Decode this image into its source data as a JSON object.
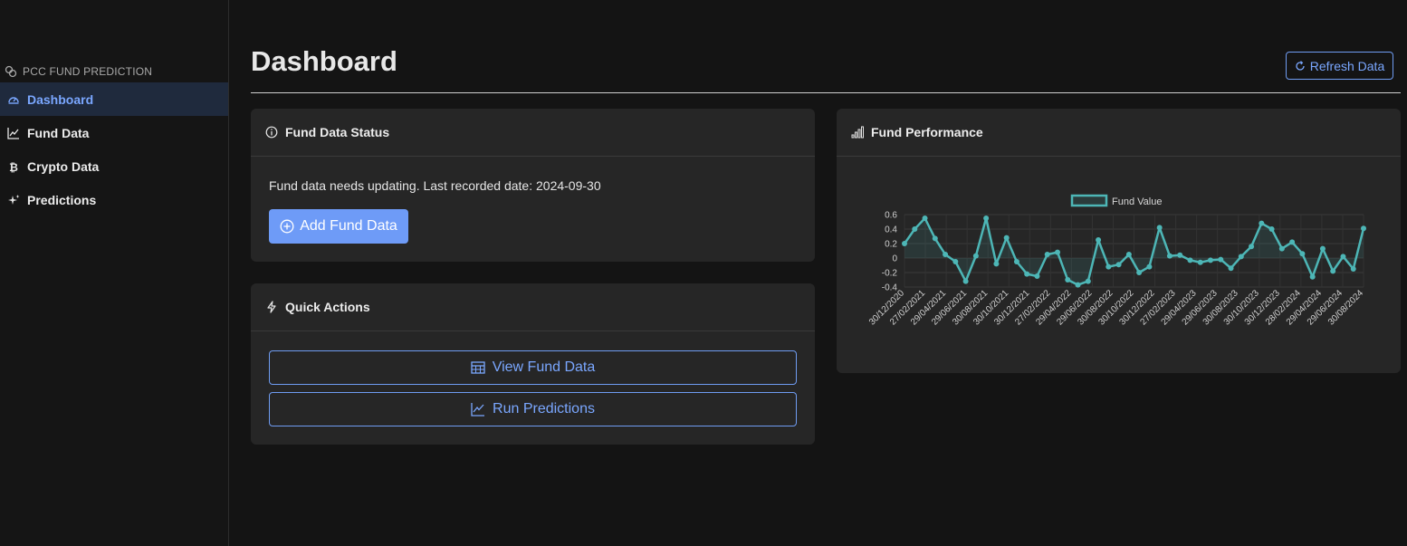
{
  "sidebar": {
    "brand": "PCC FUND PREDICTION",
    "items": [
      {
        "label": "Dashboard",
        "icon": "gauge-icon"
      },
      {
        "label": "Fund Data",
        "icon": "line-chart-icon"
      },
      {
        "label": "Crypto Data",
        "icon": "bitcoin-icon"
      },
      {
        "label": "Predictions",
        "icon": "sparkles-icon"
      }
    ]
  },
  "header": {
    "title": "Dashboard",
    "refresh_label": "Refresh Data"
  },
  "status_card": {
    "title": "Fund Data Status",
    "message": "Fund data needs updating. Last recorded date: 2024-09-30",
    "add_label": "Add Fund Data"
  },
  "actions_card": {
    "title": "Quick Actions",
    "view_label": "View Fund Data",
    "predict_label": "Run Predictions"
  },
  "performance_card": {
    "title": "Fund Performance"
  },
  "colors": {
    "accent": "#7aa7ff",
    "line": "#4db6b6",
    "active_nav_bg": "#1f2a3d"
  },
  "chart_data": {
    "type": "line",
    "legend": "top",
    "ylim": [
      -0.4,
      0.6
    ],
    "yticks": [
      0.6,
      0.4,
      0.2,
      0,
      -0.2,
      -0.4
    ],
    "xtick_labels": [
      "30/12/2020",
      "27/02/2021",
      "29/04/2021",
      "29/06/2021",
      "30/08/2021",
      "30/10/2021",
      "30/12/2021",
      "27/02/2022",
      "29/04/2022",
      "29/06/2022",
      "30/08/2022",
      "30/10/2022",
      "30/12/2022",
      "27/02/2023",
      "29/04/2023",
      "29/06/2023",
      "30/08/2023",
      "30/10/2023",
      "30/12/2023",
      "28/02/2024",
      "29/04/2024",
      "29/06/2024",
      "30/08/2024"
    ],
    "series": [
      {
        "name": "Fund Value",
        "values": [
          0.2,
          0.4,
          0.55,
          0.27,
          0.05,
          -0.05,
          -0.32,
          0.03,
          0.55,
          -0.08,
          0.28,
          -0.05,
          -0.22,
          -0.25,
          0.05,
          0.08,
          -0.3,
          -0.37,
          -0.32,
          0.25,
          -0.12,
          -0.09,
          0.05,
          -0.2,
          -0.12,
          0.42,
          0.03,
          0.04,
          -0.03,
          -0.06,
          -0.03,
          -0.02,
          -0.14,
          0.02,
          0.16,
          0.48,
          0.4,
          0.13,
          0.22,
          0.06,
          -0.26,
          0.13,
          -0.18,
          0.02,
          -0.15,
          0.41
        ]
      }
    ]
  }
}
